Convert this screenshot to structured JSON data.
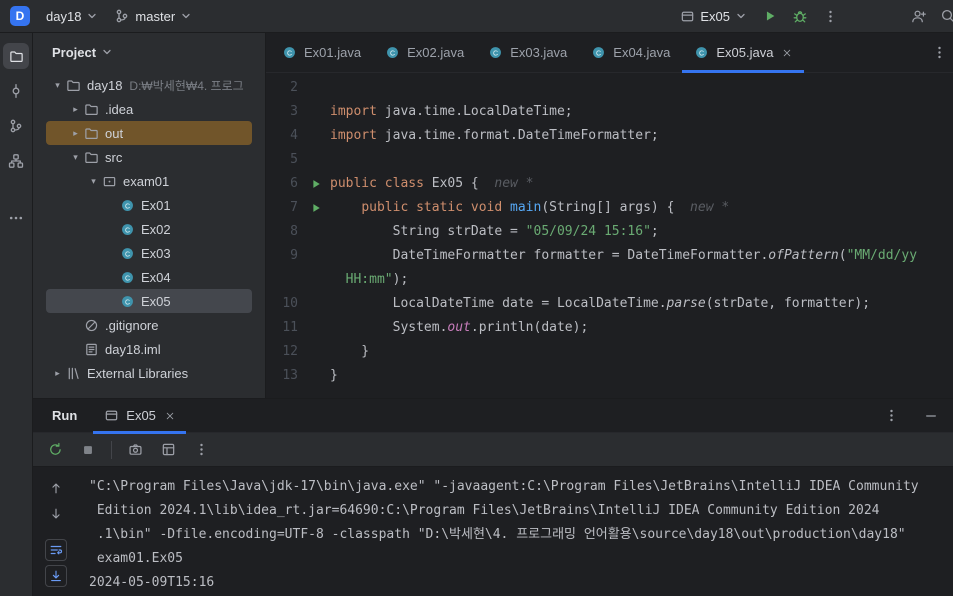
{
  "colors": {
    "accent": "#3574f0",
    "background": "#1e1f22",
    "panel": "#2b2d30",
    "keyword": "#cf8e6d",
    "string": "#6aab73",
    "method_declaration": "#56a8f5",
    "field": "#c77dbb",
    "run_green": "#5fad65",
    "out_row_highlight": "#71552a"
  },
  "titlebar": {
    "logo": "D",
    "project": "day18",
    "branch": "master",
    "run_config": "Ex05"
  },
  "project_panel": {
    "title": "Project",
    "items": [
      {
        "label": "day18",
        "hint": "D:₩박세현₩4. 프로그",
        "icon": "folder",
        "chevron": "down",
        "depth": 0
      },
      {
        "label": ".idea",
        "icon": "folder",
        "chevron": "right",
        "depth": 1
      },
      {
        "label": "out",
        "icon": "folder",
        "chevron": "right",
        "depth": 1,
        "highlight": true
      },
      {
        "label": "src",
        "icon": "folder",
        "chevron": "down",
        "depth": 1
      },
      {
        "label": "exam01",
        "icon": "package",
        "chevron": "down",
        "depth": 2
      },
      {
        "label": "Ex01",
        "icon": "class",
        "depth": 3
      },
      {
        "label": "Ex02",
        "icon": "class",
        "depth": 3
      },
      {
        "label": "Ex03",
        "icon": "class",
        "depth": 3
      },
      {
        "label": "Ex04",
        "icon": "class",
        "depth": 3
      },
      {
        "label": "Ex05",
        "icon": "class",
        "depth": 3,
        "selected": true
      },
      {
        "label": ".gitignore",
        "icon": "gitignore",
        "depth": 1
      },
      {
        "label": "day18.iml",
        "icon": "modfile",
        "depth": 1
      },
      {
        "label": "External Libraries",
        "icon": "libs",
        "chevron": "right",
        "depth": 0
      }
    ]
  },
  "editor": {
    "tabs": [
      {
        "label": "Ex01.java",
        "active": false
      },
      {
        "label": "Ex02.java",
        "active": false
      },
      {
        "label": "Ex03.java",
        "active": false
      },
      {
        "label": "Ex04.java",
        "active": false
      },
      {
        "label": "Ex05.java",
        "active": true
      }
    ],
    "code_lines": [
      {
        "num": "2",
        "tokens": []
      },
      {
        "num": "3",
        "tokens": [
          [
            "kw",
            "import "
          ],
          [
            "",
            "java.time.LocalDateTime;"
          ]
        ]
      },
      {
        "num": "4",
        "tokens": [
          [
            "kw",
            "import "
          ],
          [
            "",
            "java.time.format.DateTimeFormatter;"
          ]
        ]
      },
      {
        "num": "5",
        "tokens": []
      },
      {
        "num": "6",
        "run": true,
        "tokens": [
          [
            "kw",
            "public class "
          ],
          [
            "",
            "Ex05 {"
          ],
          [
            "hint",
            "  new *"
          ]
        ]
      },
      {
        "num": "7",
        "run": true,
        "tokens": [
          [
            "",
            "    "
          ],
          [
            "kw",
            "public static void "
          ],
          [
            "mth",
            "main"
          ],
          [
            "",
            "(String[] args) {"
          ],
          [
            "hint",
            "  new *"
          ]
        ]
      },
      {
        "num": "8",
        "tokens": [
          [
            "",
            "        String strDate = "
          ],
          [
            "str",
            "\"05/09/24 15:16\""
          ],
          [
            "",
            ";"
          ]
        ]
      },
      {
        "num": "9",
        "tokens": [
          [
            "",
            "        DateTimeFormatter formatter = DateTimeFormatter."
          ],
          [
            "sm",
            "ofPattern"
          ],
          [
            "",
            "("
          ],
          [
            "str",
            "\"MM/dd/yy"
          ]
        ]
      },
      {
        "num": "",
        "tokens": [
          [
            "",
            "  "
          ],
          [
            "str",
            "HH:mm\""
          ],
          [
            "",
            ");"
          ]
        ]
      },
      {
        "num": "10",
        "tokens": [
          [
            "",
            "        LocalDateTime date = LocalDateTime."
          ],
          [
            "sm",
            "parse"
          ],
          [
            "",
            "(strDate, formatter);"
          ]
        ]
      },
      {
        "num": "11",
        "tokens": [
          [
            "",
            "        System."
          ],
          [
            "fld",
            "out"
          ],
          [
            "",
            ".println(date);"
          ]
        ]
      },
      {
        "num": "12",
        "tokens": [
          [
            "",
            "    }"
          ]
        ]
      },
      {
        "num": "13",
        "tokens": [
          [
            "",
            "}"
          ]
        ]
      }
    ]
  },
  "run_panel": {
    "title": "Run",
    "tab_label": "Ex05",
    "console_lines": [
      "\"C:\\Program Files\\Java\\jdk-17\\bin\\java.exe\" \"-javaagent:C:\\Program Files\\JetBrains\\IntelliJ IDEA Community",
      " Edition 2024.1\\lib\\idea_rt.jar=64690:C:\\Program Files\\JetBrains\\IntelliJ IDEA Community Edition 2024",
      " .1\\bin\" -Dfile.encoding=UTF-8 -classpath \"D:\\박세현\\4. 프로그래밍 언어활용\\source\\day18\\out\\production\\day18\"",
      " exam01.Ex05",
      "2024-05-09T15:16"
    ]
  }
}
